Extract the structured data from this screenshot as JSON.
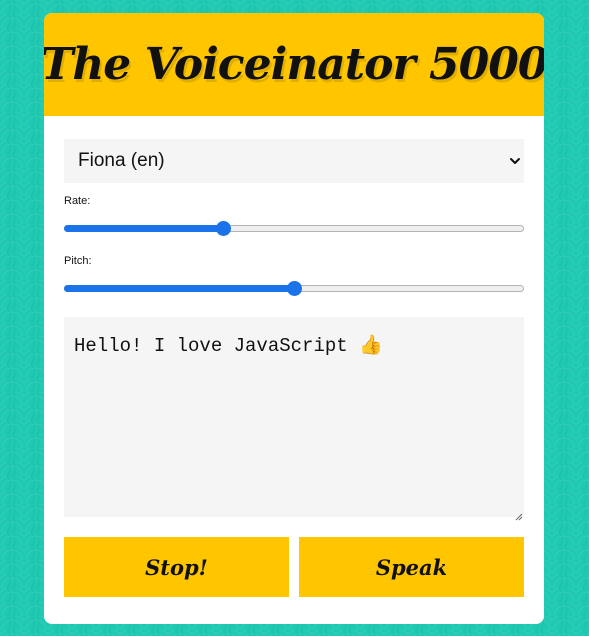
{
  "app": {
    "title": "The Voiceinator 5000"
  },
  "voice_select": {
    "selected": "Fiona (en)",
    "chevron_icon": "chevron-down-icon"
  },
  "rate": {
    "label": "Rate:",
    "value_fraction": 0.345
  },
  "pitch": {
    "label": "Pitch:",
    "value_fraction": 0.5
  },
  "message": {
    "text": "Hello! I love JavaScript 👍"
  },
  "buttons": {
    "stop_label": "Stop!",
    "speak_label": "Speak"
  },
  "colors": {
    "accent": "#ffc600",
    "background": "#1fc9b2",
    "slider": "#1a73e8"
  }
}
